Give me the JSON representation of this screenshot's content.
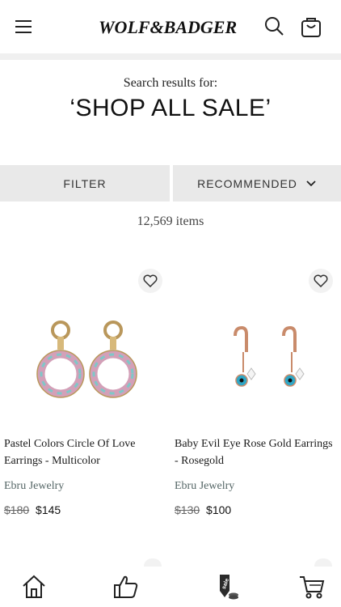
{
  "header": {
    "brand": "WOLF & BADGER",
    "menu_icon": "hamburger-menu-icon",
    "search_icon": "search-icon",
    "cart_icon": "shopping-bag-icon"
  },
  "search": {
    "heading": "Search results for:",
    "term": "‘SHOP ALL SALE’"
  },
  "controls": {
    "filter_label": "FILTER",
    "sort_label": "RECOMMENDED",
    "sort_icon": "chevron-down-icon"
  },
  "results": {
    "count_text": "12,569 items"
  },
  "products": [
    {
      "title": "Pastel Colors Circle Of Love Earrings - Multicolor",
      "brand": "Ebru Jewelry",
      "old_price": "$180",
      "new_price": "$145",
      "favorite_icon": "heart-icon"
    },
    {
      "title": "Baby Evil Eye Rose Gold Earrings - Rosegold",
      "brand": "Ebru Jewelry",
      "old_price": "$130",
      "new_price": "$100",
      "favorite_icon": "heart-icon"
    }
  ],
  "bottom_nav": {
    "items": [
      "home-icon",
      "thumbs-up-icon",
      "sale-icon",
      "cart-icon"
    ],
    "sale_text": "sale"
  },
  "colors": {
    "control_bg": "#e9e9e9",
    "divider": "#f0f0f0",
    "brand_text": "#556666"
  }
}
